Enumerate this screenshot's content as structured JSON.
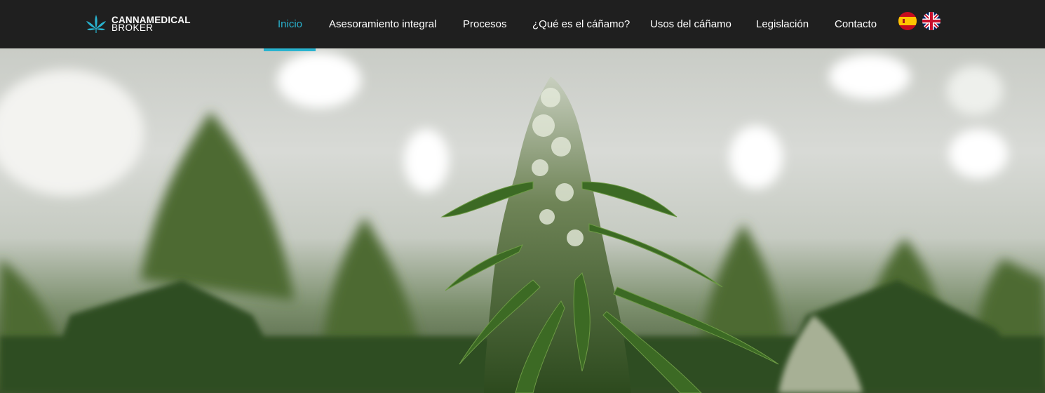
{
  "brand": {
    "line1": "CANNAMEDICAL",
    "line2": "BROKER",
    "logo_icon": "cannabis-leaf-icon",
    "accent_color": "#29b3cf"
  },
  "nav": {
    "items": [
      {
        "label": "Inicio",
        "active": true
      },
      {
        "label": "Asesoramiento integral",
        "active": false
      },
      {
        "label": "Procesos",
        "active": false
      },
      {
        "label": "¿Qué es el cáñamo?",
        "active": false
      },
      {
        "label": "Usos del cáñamo",
        "active": false
      },
      {
        "label": "Legislación",
        "active": false
      },
      {
        "label": "Contacto",
        "active": false
      }
    ]
  },
  "languages": [
    {
      "icon": "spain-flag-icon"
    },
    {
      "icon": "uk-flag-icon"
    }
  ],
  "hero": {
    "image": "cannabis-plants-greenhouse-photo"
  }
}
